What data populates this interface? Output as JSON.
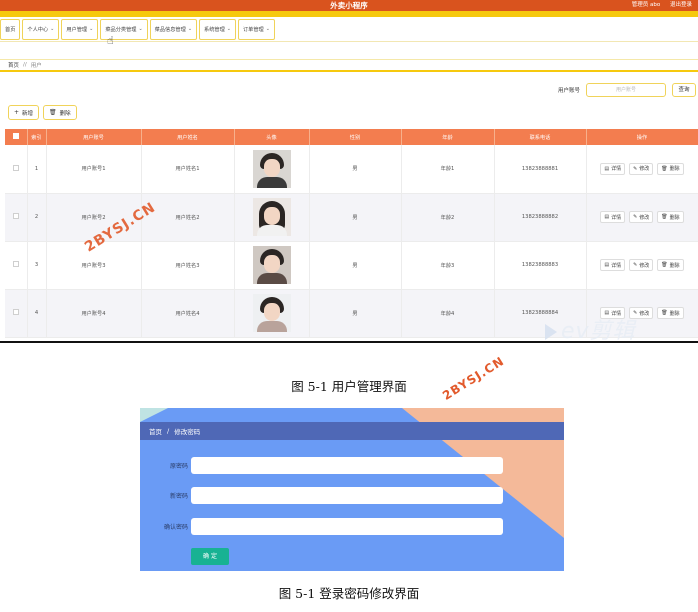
{
  "figure1": {
    "app_title": "外卖小程序",
    "top_right": [
      "管理员 abo",
      "退出登录"
    ],
    "nav": [
      {
        "label": "首页",
        "chevron": false
      },
      {
        "label": "个人中心",
        "chevron": true
      },
      {
        "label": "用户管理",
        "chevron": true
      },
      {
        "label": "菜品分类管理",
        "chevron": true
      },
      {
        "label": "菜品信息管理",
        "chevron": true
      },
      {
        "label": "系统管理",
        "chevron": true
      },
      {
        "label": "订单管理",
        "chevron": true
      }
    ],
    "breadcrumb": {
      "home": "首页",
      "sep": "//",
      "current": "用户"
    },
    "search": {
      "label": "用户账号",
      "placeholder": "用户账号",
      "button": "查询"
    },
    "ops": {
      "add": "新增",
      "delete": "删除"
    },
    "columns": [
      "索引",
      "用户账号",
      "用户姓名",
      "头像",
      "性别",
      "年龄",
      "联系电话",
      "操作"
    ],
    "rows": [
      {
        "index": "1",
        "account": "用户账号1",
        "name": "用户姓名1",
        "gender": "男",
        "age": "年龄1",
        "phone": "13823888881"
      },
      {
        "index": "2",
        "account": "用户账号2",
        "name": "用户姓名2",
        "gender": "男",
        "age": "年龄2",
        "phone": "13823888882"
      },
      {
        "index": "3",
        "account": "用户账号3",
        "name": "用户姓名3",
        "gender": "男",
        "age": "年龄3",
        "phone": "13823888883"
      },
      {
        "index": "4",
        "account": "用户账号4",
        "name": "用户姓名4",
        "gender": "男",
        "age": "年龄4",
        "phone": "13823888884"
      }
    ],
    "row_actions": {
      "detail": "详情",
      "edit": "修改",
      "delete": "删除"
    },
    "watermark_ev": "ev剪辑",
    "caption": "图 5-1 用户管理界面"
  },
  "watermark": "2BYSJ.CN",
  "figure2": {
    "breadcrumb": {
      "home": "首页",
      "sep": "/",
      "current": "修改密码"
    },
    "fields": [
      "原密码",
      "新密码",
      "确认密码"
    ],
    "submit": "确 定",
    "caption": "图 5-1 登录密码修改界面"
  },
  "colors": {
    "orange_header": "#d9531e",
    "table_header": "#f37d4f",
    "accent_yellow": "#f6c90e",
    "form_blue": "#6a9bf5",
    "form_bar": "#4f68b6",
    "submit_green": "#18b293"
  }
}
